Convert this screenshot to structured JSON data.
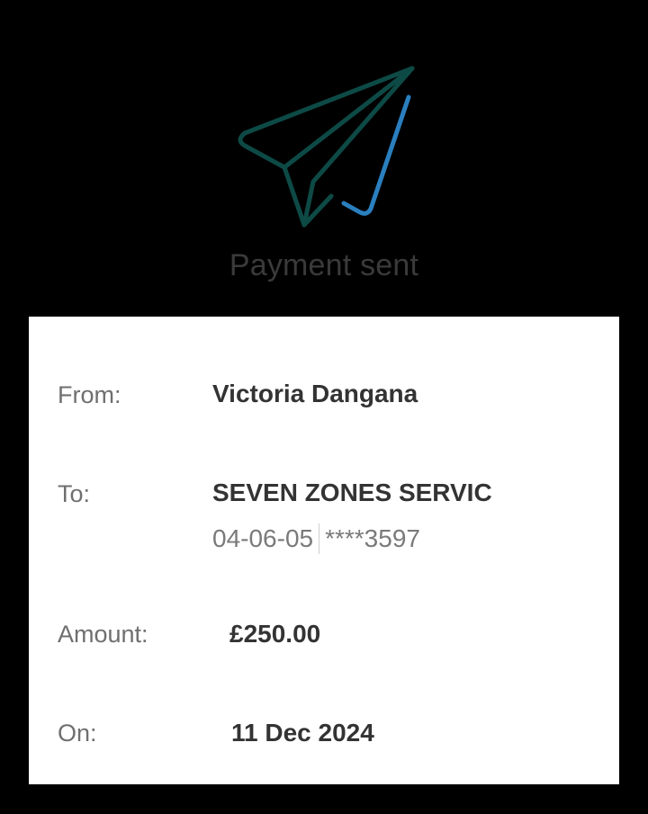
{
  "header": {
    "icon": "paper-plane-check-icon",
    "title": "Payment sent",
    "icon_colors": {
      "plane": "#0d4a46",
      "check": "#2a7fbf"
    }
  },
  "details": {
    "from_label": "From:",
    "from_value": "Victoria Dangana",
    "to_label": "To:",
    "to_value": "SEVEN ZONES SERVIC",
    "sort_code": "04-06-05",
    "account_number": "****3597",
    "amount_label": "Amount:",
    "amount_value": "£250.00",
    "on_label": "On:",
    "on_value": "11 Dec 2024"
  }
}
